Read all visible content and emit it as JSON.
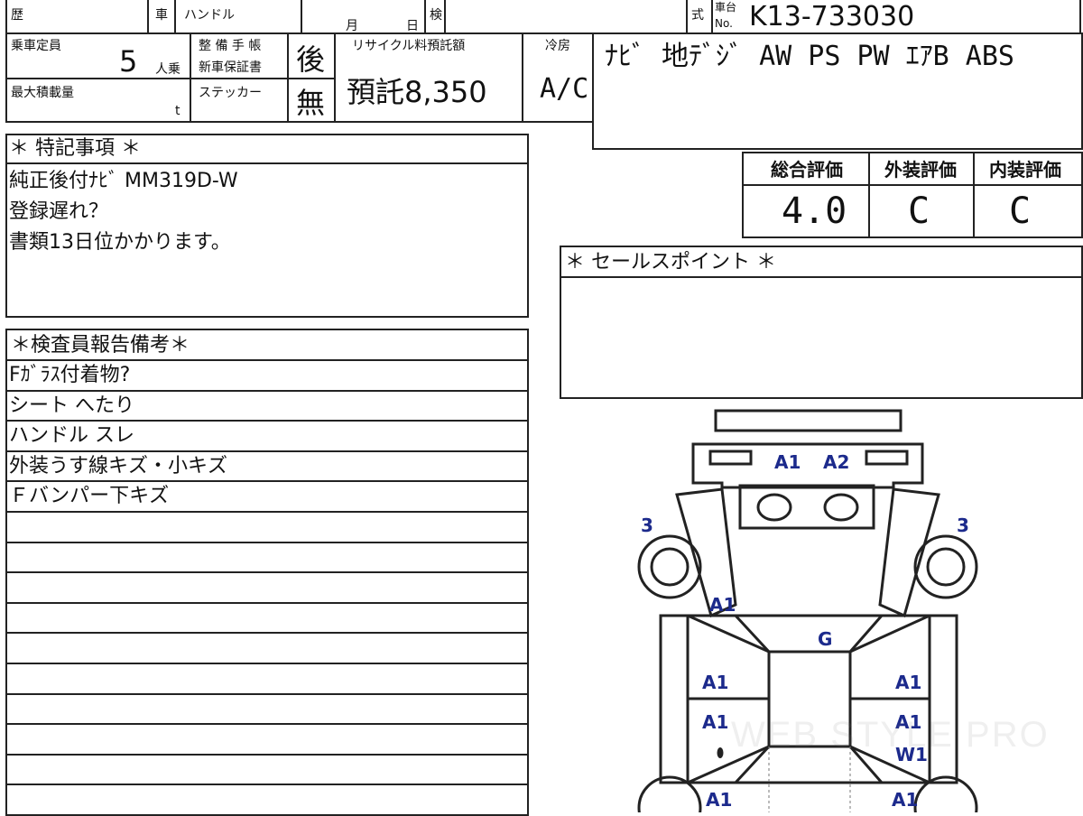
{
  "header": {
    "history_label": "歴",
    "car_label": "車",
    "handle_label": "ハンドル",
    "month_label": "月",
    "day_label": "日",
    "inspection_label": "検",
    "model_label": "式",
    "chassis_label_top": "車台",
    "chassis_label_bottom": "No.",
    "chassis_no": "K13-733030"
  },
  "specs": {
    "capacity_label": "乗車定員",
    "capacity_value": "5",
    "capacity_unit": "人乗",
    "maintenance_label": "整 備 手 帳",
    "warranty_label": "新車保証書",
    "maintenance_value": "後",
    "max_load_label": "最大積載量",
    "max_load_unit": "t",
    "sticker_label": "ステッカー",
    "sticker_value": "無",
    "recycle_label": "リサイクル料預託額",
    "recycle_value": "預託8,350",
    "ac_label": "冷房",
    "ac_value": "A/C",
    "equipment": "ﾅﾋﾞ  地ﾃﾞｼﾞ  AW  PS  PW  ｴｱB  ABS"
  },
  "ratings": {
    "overall_label": "総合評価",
    "exterior_label": "外装評価",
    "interior_label": "内装評価",
    "overall_value": "4.0",
    "exterior_value": "C",
    "interior_value": "C"
  },
  "special_notes": {
    "title": "＊ 特記事項 ＊",
    "lines": [
      "純正後付ﾅﾋﾞ MM319D-W",
      "登録遅れ？",
      "書類13日位かかります。"
    ]
  },
  "sales_points": {
    "title": "＊ セールスポイント ＊"
  },
  "inspector_notes": {
    "title": "＊検査員報告備考＊",
    "rows": [
      "Fｶﾞﾗｽ付着物?",
      "シート へたり",
      "ハンドル スレ",
      "外装うす線キズ・小キズ",
      "Ｆバンパー下キズ",
      "",
      "",
      "",
      "",
      "",
      "",
      "",
      "",
      "",
      ""
    ]
  },
  "diagram": {
    "marks": [
      {
        "id": "front-bumper-left",
        "label": "A1"
      },
      {
        "id": "front-bumper-right",
        "label": "A2"
      },
      {
        "id": "front-left-wheel",
        "label": "3"
      },
      {
        "id": "front-right-wheel",
        "label": "3"
      },
      {
        "id": "left-front-pillar",
        "label": "A1"
      },
      {
        "id": "roof",
        "label": "G"
      },
      {
        "id": "left-front-door",
        "label": "A1"
      },
      {
        "id": "right-front-door",
        "label": "A1"
      },
      {
        "id": "left-rear-door",
        "label": "A1"
      },
      {
        "id": "right-rear-door",
        "label": "A1"
      },
      {
        "id": "right-rear-door-w",
        "label": "W1"
      },
      {
        "id": "left-rear-quarter",
        "label": "A1"
      },
      {
        "id": "right-rear-quarter",
        "label": "A1"
      }
    ],
    "watermark": "WEB STYLE PRO"
  }
}
